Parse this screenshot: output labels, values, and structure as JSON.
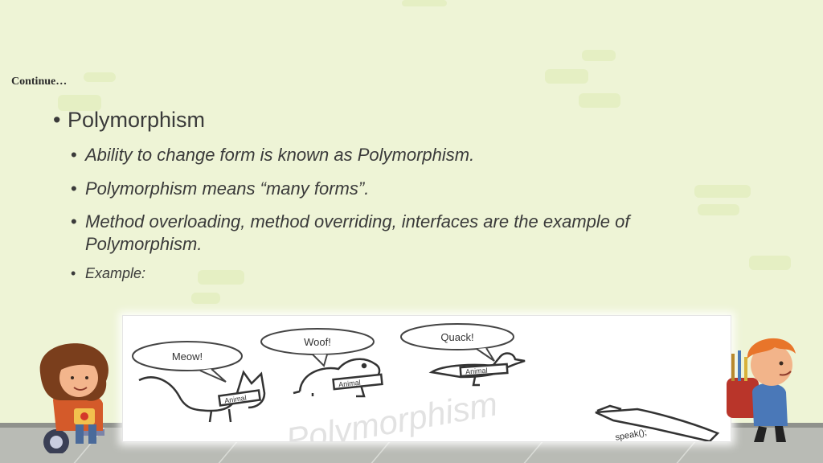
{
  "slide": {
    "title": "Continue…",
    "heading": "Polymorphism",
    "bullets": [
      "Ability to change form is known as Polymorphism.",
      "Polymorphism means “many forms”.",
      "Method overloading, method overriding, interfaces are the example of",
      "Polymorphism."
    ],
    "example_label": "Example:"
  },
  "illustration": {
    "bubbles": [
      "Meow!",
      "Woof!",
      "Quack!"
    ],
    "tag": "Animal",
    "watermark": "Polymorphism",
    "method": "speak();"
  }
}
